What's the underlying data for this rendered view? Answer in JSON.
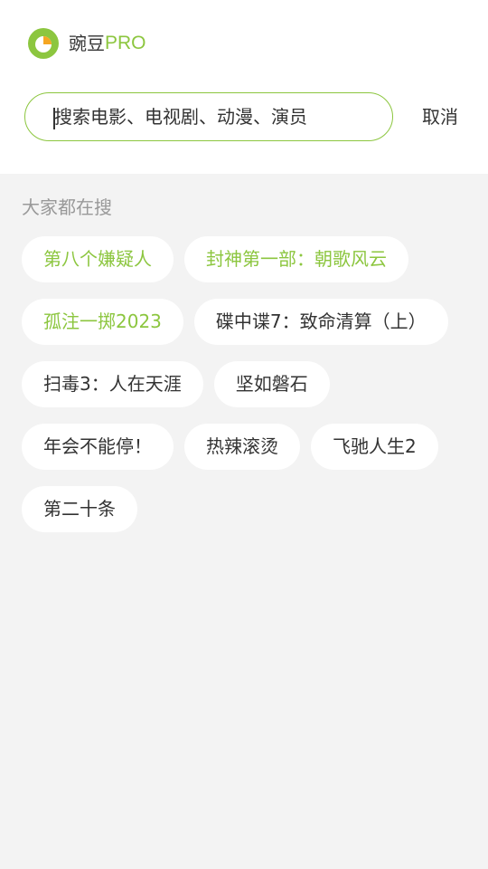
{
  "brand": {
    "logo_icon": "wandou-logo-icon",
    "name_cn": "豌豆",
    "name_pro": "PRO",
    "accent_color": "#8cc63f",
    "accent_orange": "#f5a623"
  },
  "search": {
    "placeholder": "搜索电影、电视剧、动漫、演员",
    "value": "",
    "cancel_label": "取消"
  },
  "hot_search": {
    "title": "大家都在搜",
    "tags": [
      {
        "label": "第八个嫌疑人",
        "highlight": true
      },
      {
        "label": "封神第一部：朝歌风云",
        "highlight": true
      },
      {
        "label": "孤注一掷2023",
        "highlight": true
      },
      {
        "label": "碟中谍7：致命清算（上）",
        "highlight": false
      },
      {
        "label": "扫毒3：人在天涯",
        "highlight": false
      },
      {
        "label": "坚如磐石",
        "highlight": false
      },
      {
        "label": "年会不能停！",
        "highlight": false
      },
      {
        "label": "热辣滚烫",
        "highlight": false
      },
      {
        "label": "飞驰人生2",
        "highlight": false
      },
      {
        "label": "第二十条",
        "highlight": false
      }
    ]
  }
}
